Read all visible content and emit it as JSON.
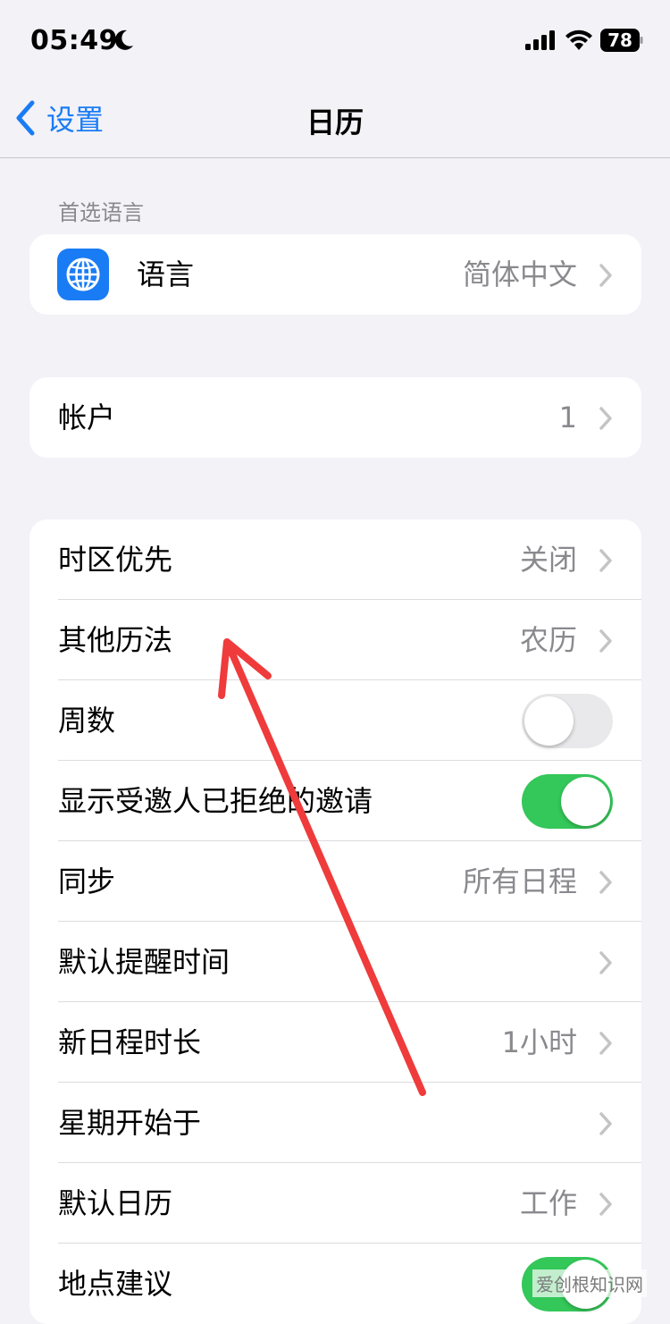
{
  "status_bar": {
    "time": "05:49",
    "battery": "78"
  },
  "nav": {
    "back_label": "设置",
    "title": "日历"
  },
  "sections": {
    "language_header": "首选语言",
    "language": {
      "label": "语言",
      "value": "简体中文"
    },
    "accounts": {
      "label": "帐户",
      "value": "1"
    },
    "settings": [
      {
        "label": "时区优先",
        "value": "关闭"
      },
      {
        "label": "其他历法",
        "value": "农历"
      },
      {
        "label": "周数",
        "toggle": "off"
      },
      {
        "label": "显示受邀人已拒绝的邀请",
        "toggle": "on"
      },
      {
        "label": "同步",
        "value": "所有日程"
      },
      {
        "label": "默认提醒时间",
        "value": ""
      },
      {
        "label": "新日程时长",
        "value": "1小时"
      },
      {
        "label": "星期开始于",
        "value": ""
      },
      {
        "label": "默认日历",
        "value": "工作"
      },
      {
        "label": "地点建议",
        "toggle": "on"
      }
    ]
  },
  "watermark": "爱创根知识网",
  "colors": {
    "accent": "#1a7cf5",
    "toggle_on": "#34c759",
    "annotation": "#ef3b3b"
  }
}
